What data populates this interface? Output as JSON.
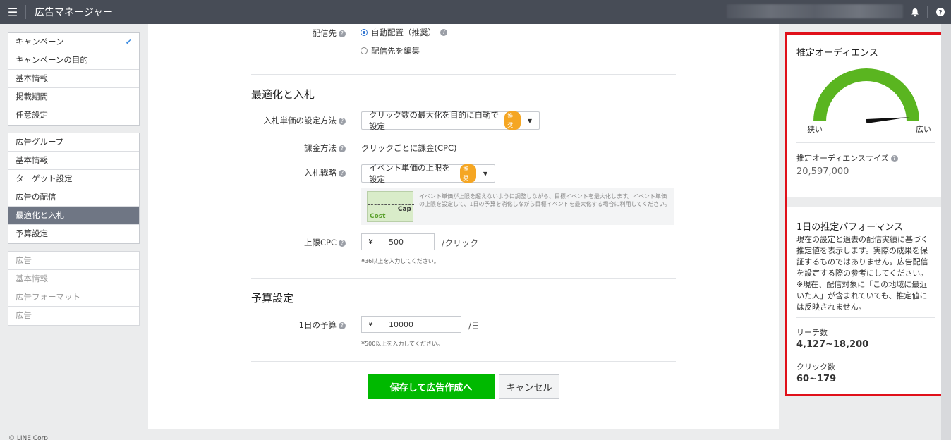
{
  "topbar": {
    "menu_icon": "☰",
    "title": "広告マネージャー",
    "bell_icon": "bell-icon",
    "help_icon": "help-icon"
  },
  "sidebar": {
    "campaign": {
      "header": "キャンペーン",
      "items": [
        "キャンペーンの目的",
        "基本情報",
        "掲載期間",
        "任意設定"
      ]
    },
    "adgroup": {
      "header": "広告グループ",
      "items": [
        "基本情報",
        "ターゲット設定",
        "広告の配信",
        "最適化と入札",
        "予算設定"
      ],
      "active": "最適化と入札"
    },
    "ad": {
      "header": "広告",
      "items": [
        "基本情報",
        "広告フォーマット",
        "広告"
      ]
    }
  },
  "placement": {
    "label": "配信先",
    "option_auto": "自動配置（推奨）",
    "option_edit": "配信先を編集"
  },
  "optimization": {
    "title": "最適化と入札",
    "bid_method_label": "入札単価の設定方法",
    "bid_method_value": "クリック数の最大化を目的に自動で設定",
    "recommend_badge": "推奨",
    "billing_label": "課金方法",
    "billing_value": "クリックごとに課金(CPC)",
    "strategy_label": "入札戦略",
    "strategy_value": "イベント単価の上限を設定",
    "hint_cost": "Cost",
    "hint_cap": "Cap",
    "hint_text": "イベント単価が上限を超えないように調整しながら、目標イベントを最大化します。イベント単価の上限を設定して、1日の予算を消化しながら目標イベントを最大化する場合に利用してください。",
    "cap_label": "上限CPC",
    "currency": "¥",
    "cap_value": "500",
    "cap_unit": "/クリック",
    "cap_note": "¥36以上を入力してください。"
  },
  "budget": {
    "title": "予算設定",
    "daily_label": "1日の予算",
    "currency": "¥",
    "daily_value": "10000",
    "daily_unit": "/日",
    "daily_note": "¥500以上を入力してください。"
  },
  "buttons": {
    "save": "保存して広告作成へ",
    "cancel": "キャンセル"
  },
  "audience": {
    "title": "推定オーディエンス",
    "narrow": "狭い",
    "wide": "広い",
    "size_label": "推定オーディエンスサイズ",
    "size_value": "20,597,000",
    "gauge_level": 0.97,
    "gauge_color": "#5ab520"
  },
  "performance": {
    "title": "1日の推定パフォーマンス",
    "description": "現在の設定と過去の配信実績に基づく推定値を表示します。実際の成果を保証するものではありません。広告配信を設定する際の参考にしてください。※現在、配信対象に「この地域に最近いた人」が含まれていても、推定値には反映されません。",
    "reach_label": "リーチ数",
    "reach_value": "4,127~18,200",
    "click_label": "クリック数",
    "click_value": "60~179"
  },
  "footer": {
    "copyright": "© LINE Corp"
  }
}
